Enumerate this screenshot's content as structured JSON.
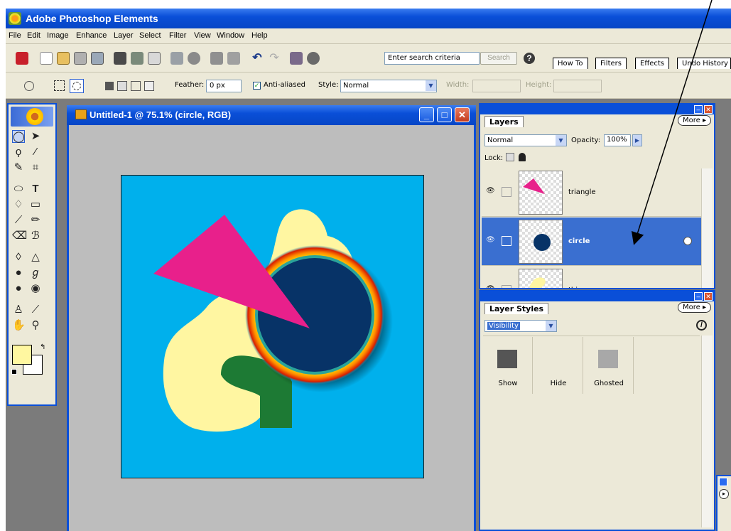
{
  "app": {
    "title": "Adobe Photoshop Elements"
  },
  "menu": [
    "File",
    "Edit",
    "Image",
    "Enhance",
    "Layer",
    "Select",
    "Filter",
    "View",
    "Window",
    "Help"
  ],
  "shortcuts": {
    "search_placeholder": "Enter search criteria",
    "search_button": "Search",
    "help_label": "?",
    "tabs": [
      "How To",
      "Filters",
      "Effects",
      "Undo History"
    ]
  },
  "options": {
    "feather_label": "Feather:",
    "feather_value": "0 px",
    "anti_aliased_label": "Anti-aliased",
    "anti_aliased_checked": true,
    "style_label": "Style:",
    "style_value": "Normal",
    "width_label": "Width:",
    "height_label": "Height:"
  },
  "document": {
    "title": "Untitled-1 @ 75.1% (circle, RGB)",
    "canvas_colors": {
      "background": "#00b0ec",
      "blob": "#fff6a1",
      "triangle": "#e8208b",
      "circle": "#073367",
      "stroke": "#1d7a34"
    }
  },
  "layers_panel": {
    "tab": "Layers",
    "more": "More",
    "blend_mode": "Normal",
    "opacity_label": "Opacity:",
    "opacity_value": "100%",
    "lock_label": "Lock:",
    "layers": [
      {
        "name": "triangle",
        "visible": true,
        "selected": false
      },
      {
        "name": "circle",
        "visible": true,
        "selected": true
      },
      {
        "name": "thing",
        "visible": true,
        "selected": false
      }
    ]
  },
  "layer_styles_panel": {
    "tab": "Layer Styles",
    "more": "More",
    "category": "Visibility",
    "styles": [
      {
        "name": "Show",
        "color": "#555555"
      },
      {
        "name": "Hide",
        "color": "#ece9d8"
      },
      {
        "name": "Ghosted",
        "color": "#a8a8a8"
      }
    ]
  }
}
